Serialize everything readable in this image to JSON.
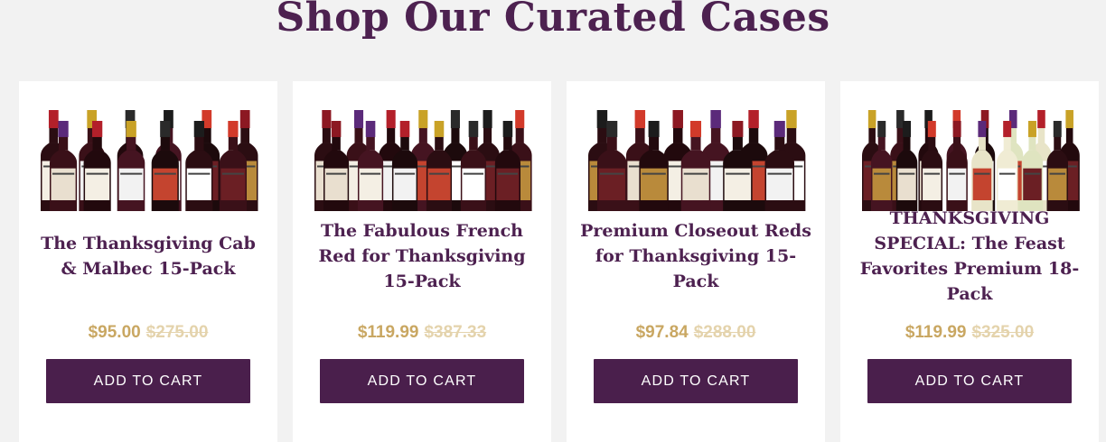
{
  "section": {
    "title": "Shop Our Curated Cases"
  },
  "products": [
    {
      "title": "The Thanksgiving Cab & Malbec 15-Pack",
      "price": "$95.00",
      "original_price": "$275.00",
      "button": "ADD TO CART",
      "image": "wine-bottles-red-case"
    },
    {
      "title": "The Fabulous French Red for Thanksgiving 15-Pack",
      "price": "$119.99",
      "original_price": "$387.33",
      "button": "ADD TO CART",
      "image": "wine-bottles-french-red-case"
    },
    {
      "title": "Premium Closeout Reds for Thanksgiving 15-Pack",
      "price": "$97.84",
      "original_price": "$288.00",
      "button": "ADD TO CART",
      "image": "wine-bottles-premium-reds-case"
    },
    {
      "title": "THANKSGIVING SPECIAL: The Feast Favorites Premium 18-Pack",
      "price": "$119.99",
      "original_price": "$325.00",
      "button": "ADD TO CART",
      "image": "wine-bottles-mixed-case"
    }
  ],
  "colors": {
    "heading": "#4d2150",
    "button_bg": "#4a1f4c",
    "price_sale": "#c9a762",
    "price_original": "#e4d3ac",
    "card_bg": "#ffffff",
    "page_bg": "#f2f2f2"
  }
}
